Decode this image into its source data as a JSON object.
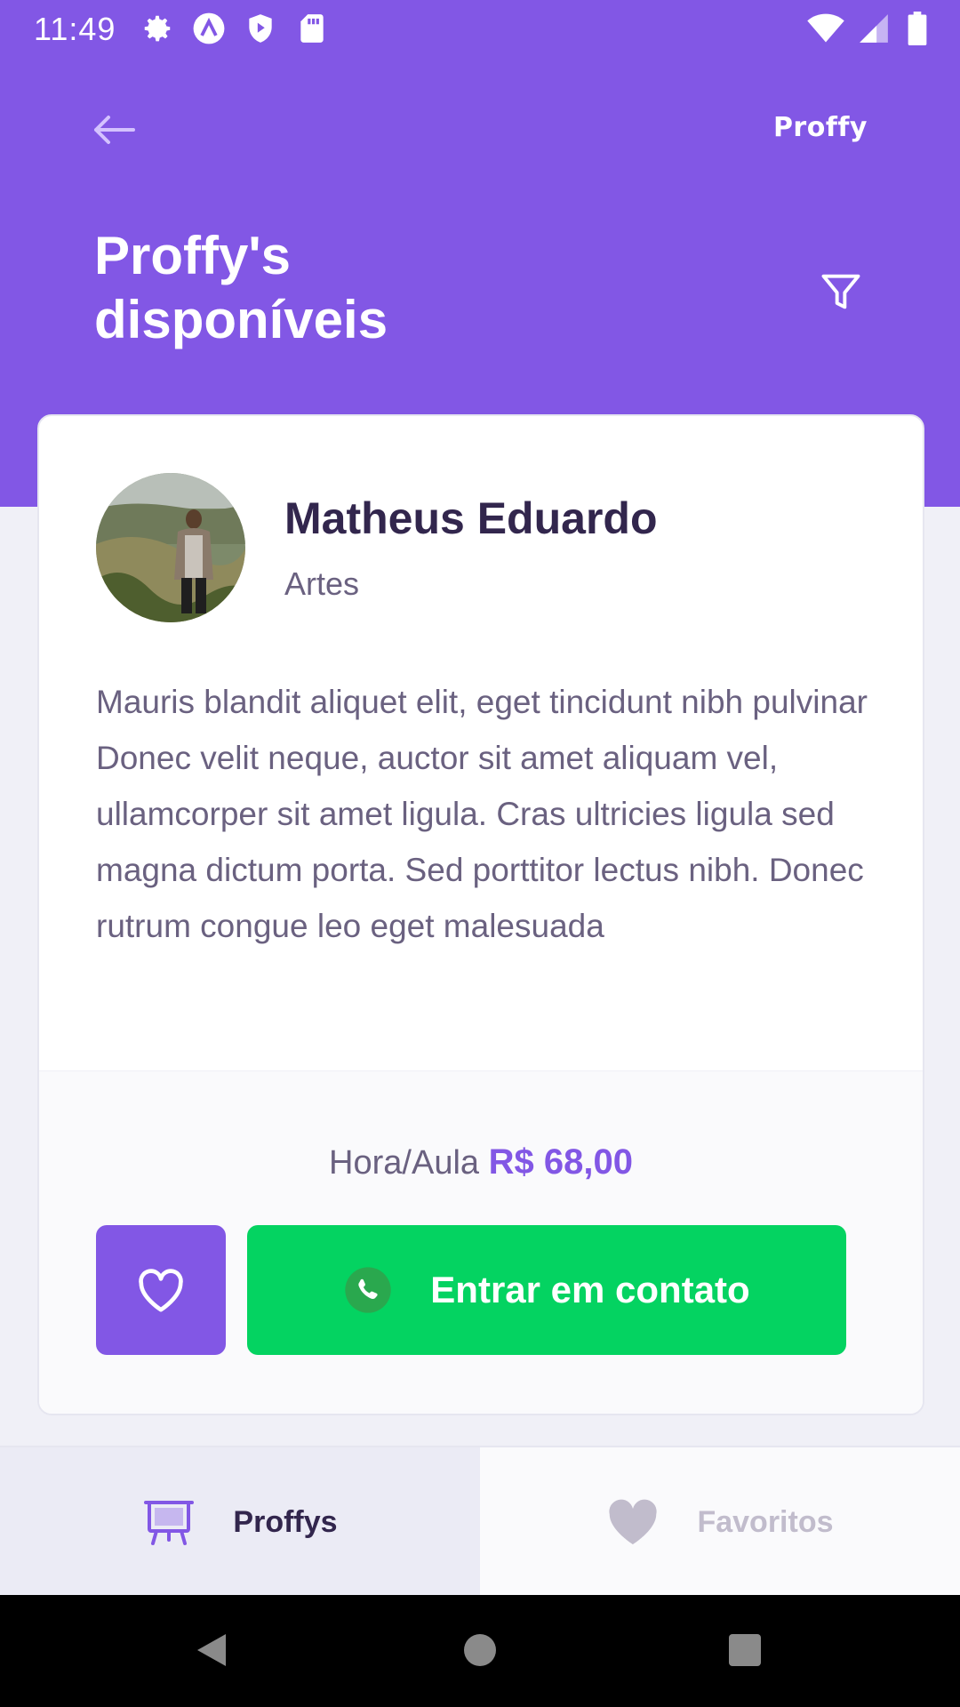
{
  "status_bar": {
    "time": "11:49",
    "left_icons": [
      "gear-icon",
      "a-circle-icon",
      "shield-play-icon",
      "sd-card-icon"
    ],
    "right_icons": [
      "wifi-icon",
      "signal-icon",
      "battery-icon"
    ]
  },
  "header": {
    "brand": "Proffy",
    "title_line1": "Proffy's",
    "title_line2": "disponíveis"
  },
  "teacher": {
    "name": "Matheus Eduardo",
    "subject": "Artes",
    "bio": "Mauris blandit aliquet elit, eget tincidunt nibh pulvinar Donec velit neque, auctor sit amet aliquam vel, ullamcorper sit amet ligula. Cras ultricies ligula sed magna dictum porta. Sed porttitor lectus nibh. Donec rutrum congue leo eget malesuada",
    "price_label": "Hora/Aula",
    "price_value": "R$ 68,00"
  },
  "actions": {
    "contact_label": "Entrar em contato"
  },
  "tabs": [
    {
      "label": "Proffys",
      "icon": "easel-icon",
      "active": true
    },
    {
      "label": "Favoritos",
      "icon": "heart-icon",
      "active": false
    }
  ],
  "colors": {
    "primary": "#8257e5",
    "success": "#04d361",
    "title_text": "#32264d",
    "body_text": "#6a6180",
    "background": "#f0f0f7"
  }
}
